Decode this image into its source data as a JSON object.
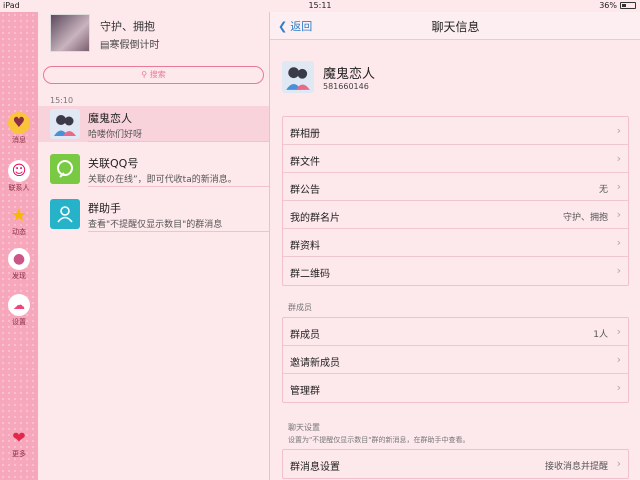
{
  "status_bar": {
    "device": "iPad",
    "time": "15:11",
    "battery": "36%",
    "battery_level": 0.36
  },
  "rail": {
    "items": [
      {
        "label": "消息",
        "icon": "duck-icon"
      },
      {
        "label": "联系人",
        "icon": "bunny-icon"
      },
      {
        "label": "动态",
        "icon": "star-icon"
      },
      {
        "label": "发现",
        "icon": "egg-icon"
      },
      {
        "label": "设置",
        "icon": "cloud-icon"
      }
    ],
    "more": {
      "label": "更多",
      "icon": "heart-icon"
    }
  },
  "list": {
    "group_name": "守护、拥抱",
    "group_sub": "寒假倒计时",
    "search_placeholder": "搜索",
    "time_label": "15:10",
    "conversations": [
      {
        "title": "魔鬼恋人",
        "preview": "哈喽你们好呀"
      },
      {
        "title": "关联QQ号",
        "preview": "关联の在线”，即可代收ta的新消息。"
      },
      {
        "title": "群助手",
        "preview": "查看\"不提醒仅显示数目\"的群消息"
      }
    ]
  },
  "pane": {
    "back": "返回",
    "title": "聊天信息",
    "profile": {
      "name": "魔鬼恋人",
      "id": "581660146"
    },
    "group_rows": [
      {
        "label": "群相册",
        "value": ""
      },
      {
        "label": "群文件",
        "value": ""
      },
      {
        "label": "群公告",
        "value": "无"
      },
      {
        "label": "我的群名片",
        "value": "守护、拥抱"
      },
      {
        "label": "群资料",
        "value": ""
      },
      {
        "label": "群二维码",
        "value": ""
      }
    ],
    "members_section": "群成员",
    "member_rows": [
      {
        "label": "群成员",
        "value": "1人"
      },
      {
        "label": "邀请新成员",
        "value": ""
      },
      {
        "label": "管理群",
        "value": ""
      }
    ],
    "chat_section": "聊天设置",
    "chat_note": "设置为\"不提醒仅显示数目\"群的新消息，在群助手中查看。",
    "chat_rows": [
      {
        "label": "群消息设置",
        "value": "接收消息并提醒"
      }
    ]
  }
}
